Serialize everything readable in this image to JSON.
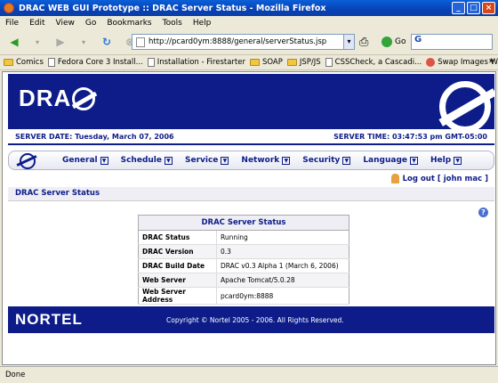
{
  "window": {
    "title": "DRAC WEB GUI Prototype :: DRAC Server Status - Mozilla Firefox"
  },
  "menu": [
    "File",
    "Edit",
    "View",
    "Go",
    "Bookmarks",
    "Tools",
    "Help"
  ],
  "toolbar": {
    "url": "http://pcard0ym:8888/general/serverStatus.jsp",
    "go_label": "Go",
    "search_value": "G"
  },
  "bookmarks": [
    {
      "label": "Comics",
      "icon": "folder-icon"
    },
    {
      "label": "Fedora Core 3 Install...",
      "icon": "fedora-icon"
    },
    {
      "label": "Installation - Firestarter",
      "icon": "page-icon"
    },
    {
      "label": "SOAP",
      "icon": "folder-icon"
    },
    {
      "label": "JSP/JS",
      "icon": "folder-icon"
    },
    {
      "label": "CSSCheck, a Cascadi...",
      "icon": "page-icon"
    },
    {
      "label": "Swap Images With J...",
      "icon": "site-icon"
    }
  ],
  "header": {
    "logo_text": "DRA",
    "server_date": "SERVER DATE: Tuesday, March 07, 2006",
    "server_time": "SERVER TIME: 03:47:53 pm GMT-05:00"
  },
  "nav": [
    {
      "label": "General"
    },
    {
      "label": "Schedule"
    },
    {
      "label": "Service"
    },
    {
      "label": "Network"
    },
    {
      "label": "Security"
    },
    {
      "label": "Language"
    },
    {
      "label": "Help"
    }
  ],
  "user": {
    "logout_text": "Log out [ john mac ]"
  },
  "section": {
    "title": "DRAC Server Status"
  },
  "status_table": {
    "title": "DRAC Server Status",
    "rows": [
      {
        "key": "DRAC Status",
        "value": "Running"
      },
      {
        "key": "DRAC Version",
        "value": "0.3"
      },
      {
        "key": "DRAC Build Date",
        "value": "DRAC v0.3 Alpha 1 (March 6, 2006)"
      },
      {
        "key": "Web Server",
        "value": "Apache Tomcat/5.0.28"
      },
      {
        "key": "Web Server Address",
        "value": "pcard0ym:8888"
      }
    ]
  },
  "footer": {
    "brand": "NORTEL",
    "copyright": "Copyright © Nortel 2005 - 2006. All Rights Reserved."
  },
  "statusbar": {
    "text": "Done"
  },
  "colors": {
    "brand_blue": "#0d1c89",
    "title_blue": "#0841b5"
  }
}
